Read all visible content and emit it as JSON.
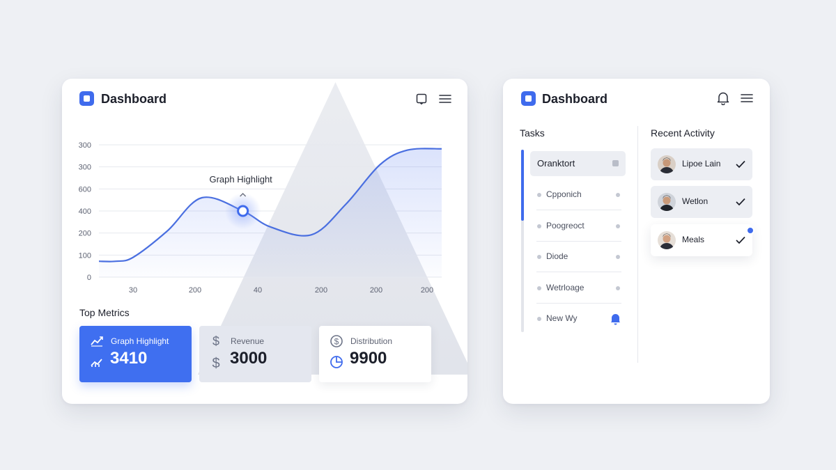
{
  "left_panel": {
    "title": "Dashboard",
    "header_icons": [
      "square-icon",
      "menu-icon"
    ],
    "chart_data": {
      "type": "area",
      "highlight_label": "Graph Highlight",
      "y_tick_labels": [
        "300",
        "300",
        "600",
        "400",
        "200",
        "100",
        "0"
      ],
      "x_tick_labels": [
        "30",
        "200",
        "40",
        "200",
        "200",
        "200"
      ],
      "series": [
        {
          "x": [
            0,
            0.05,
            0.1,
            0.2,
            0.3,
            0.42,
            0.5,
            0.62,
            0.72,
            0.82,
            0.9,
            1.0
          ],
          "values": [
            0.12,
            0.12,
            0.15,
            0.35,
            0.6,
            0.5,
            0.38,
            0.32,
            0.55,
            0.85,
            0.96,
            0.97
          ]
        }
      ],
      "highlight_x": 0.42,
      "grid": true,
      "accent": "#3f6bed"
    },
    "metrics_title": "Top Metrics",
    "metrics": [
      {
        "label": "Graph Highlight",
        "value": "3410",
        "icon": "trend-up-icon"
      },
      {
        "label": "Revenue",
        "value": "3000",
        "icon": "dollar-icon"
      },
      {
        "label": "Distribution",
        "value": "9900",
        "icon": "pie-chart-icon"
      }
    ]
  },
  "right_panel": {
    "title": "Dashboard",
    "header_icons": [
      "bell-icon",
      "menu-icon"
    ],
    "tasks_title": "Tasks",
    "tasks": [
      {
        "label": "Oranktort",
        "selected": true
      },
      {
        "label": "Cpponich"
      },
      {
        "label": "Poogreoct"
      },
      {
        "label": "Diode"
      },
      {
        "label": "Wetrloage"
      },
      {
        "label": "New Wy",
        "icon": "bell-icon"
      }
    ],
    "activity_title": "Recent Activity",
    "activity": [
      {
        "name": "Lipoe Lain"
      },
      {
        "name": "Wetlon"
      },
      {
        "name": "Meals",
        "badge": true
      }
    ]
  },
  "colors": {
    "accent": "#3f6bed",
    "background": "#eef0f4",
    "card": "#ffffff"
  }
}
